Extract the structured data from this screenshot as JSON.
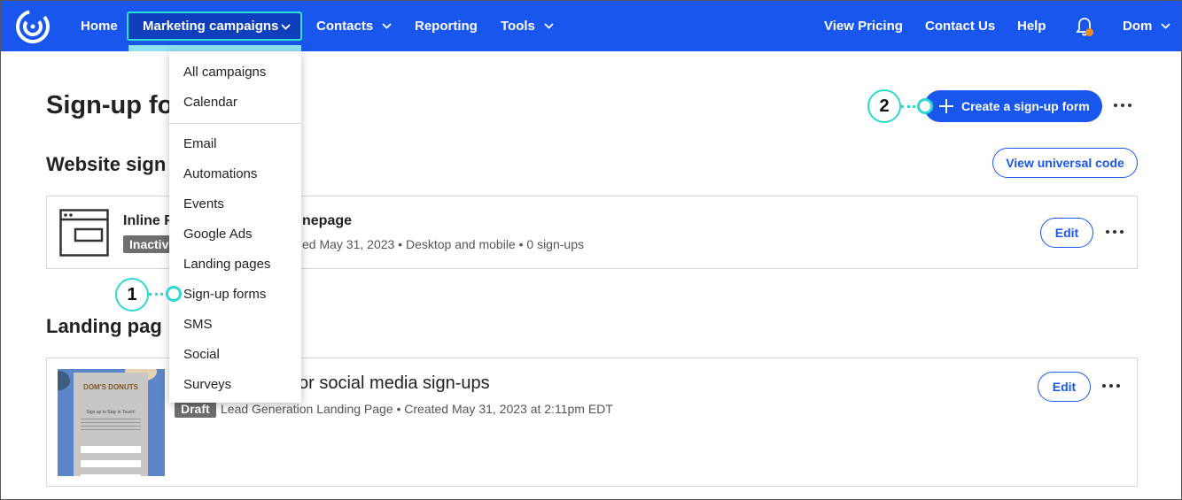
{
  "nav": {
    "home": "Home",
    "marketing": "Marketing campaigns",
    "contacts": "Contacts",
    "reporting": "Reporting",
    "tools": "Tools",
    "view_pricing": "View Pricing",
    "contact_us": "Contact Us",
    "help": "Help",
    "user": "Dom"
  },
  "menu": {
    "items": [
      "All campaigns",
      "Calendar",
      "Email",
      "Automations",
      "Events",
      "Google Ads",
      "Landing pages",
      "Sign-up forms",
      "SMS",
      "Social",
      "Surveys"
    ]
  },
  "page": {
    "title": "Sign-up fo",
    "create_button": "Create a sign-up form",
    "universal_code_button": "View universal code"
  },
  "sections": {
    "website": "Website sign",
    "landing": "Landing pag"
  },
  "card1": {
    "title_left": "Inline F",
    "title_right": "nepage",
    "badge": "Inactiv",
    "meta": "ed May 31, 2023 • Desktop and mobile • 0 sign-ups",
    "edit": "Edit"
  },
  "card2": {
    "title": "or social media sign-ups",
    "badge": "Draft",
    "meta": "Lead Generation Landing Page • Created May 31, 2023 at 2:11pm EDT",
    "edit": "Edit",
    "thumb_brand": "DOM'S DONUTS",
    "thumb_heading": "Sign up to Stay in Touch!"
  },
  "callouts": {
    "one": "1",
    "two": "2"
  },
  "colors": {
    "brand_blue": "#1856ed",
    "callout_teal": "#2fd8cf",
    "notification_dot": "#f28c1b"
  }
}
